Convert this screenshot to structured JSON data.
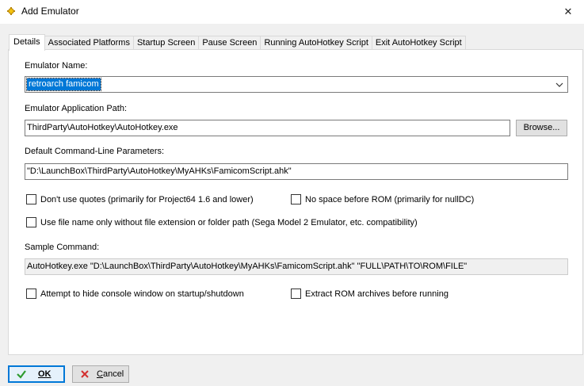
{
  "window": {
    "title": "Add Emulator",
    "close_glyph": "✕"
  },
  "tabs": [
    {
      "label": "Details"
    },
    {
      "label": "Associated Platforms"
    },
    {
      "label": "Startup Screen"
    },
    {
      "label": "Pause Screen"
    },
    {
      "label": "Running AutoHotkey Script"
    },
    {
      "label": "Exit AutoHotkey Script"
    }
  ],
  "form": {
    "emulator_name_label": "Emulator Name:",
    "emulator_name_value": "retroarch famicom",
    "app_path_label": "Emulator Application Path:",
    "app_path_value": "ThirdParty\\AutoHotkey\\AutoHotkey.exe",
    "browse_label": "Browse...",
    "params_label": "Default Command-Line Parameters:",
    "params_value": "\"D:\\LaunchBox\\ThirdParty\\AutoHotkey\\MyAHKs\\FamicomScript.ahk\"",
    "dont_use_quotes_label": "Don't use quotes (primarily for Project64 1.6 and lower)",
    "no_space_label": "No space before ROM (primarily for nullDC)",
    "file_name_only_label": "Use file name only without file extension or folder path (Sega Model 2 Emulator, etc. compatibility)",
    "sample_command_label": "Sample Command:",
    "sample_command_value": "AutoHotkey.exe \"D:\\LaunchBox\\ThirdParty\\AutoHotkey\\MyAHKs\\FamicomScript.ahk\" \"FULL\\PATH\\TO\\ROM\\FILE\"",
    "hide_console_label": "Attempt to hide console window on startup/shutdown",
    "extract_rom_label": "Extract ROM archives before running"
  },
  "footer": {
    "ok_label": "OK",
    "cancel_label": "Cancel"
  },
  "colors": {
    "accent": "#0078d7",
    "ok_check": "#2e9b2e",
    "cancel_x": "#d32f2f"
  }
}
